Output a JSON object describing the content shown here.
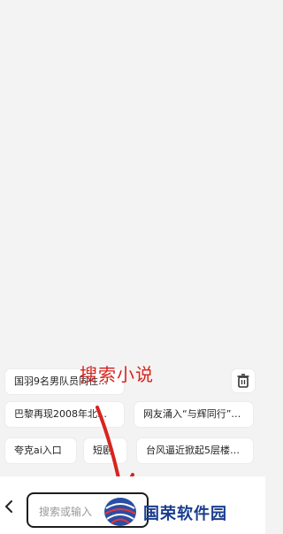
{
  "history_chips": [
    "国羽9名男队员同住…",
    "巴黎再现2008年北…",
    "网友涌入“与辉同行”…",
    "夸克ai入口",
    "短剧",
    "台风逼近掀起5层楼…"
  ],
  "annotation": "搜索小说",
  "search": {
    "placeholder": "搜索或输入"
  },
  "watermark": {
    "brand": "国荣软件园"
  },
  "icons": {
    "trash": "trash-icon",
    "back": "chevron-left-icon",
    "logo": "globe-logo-icon"
  },
  "colors": {
    "annotation": "#d8231e",
    "brand": "#1a3d8f"
  }
}
